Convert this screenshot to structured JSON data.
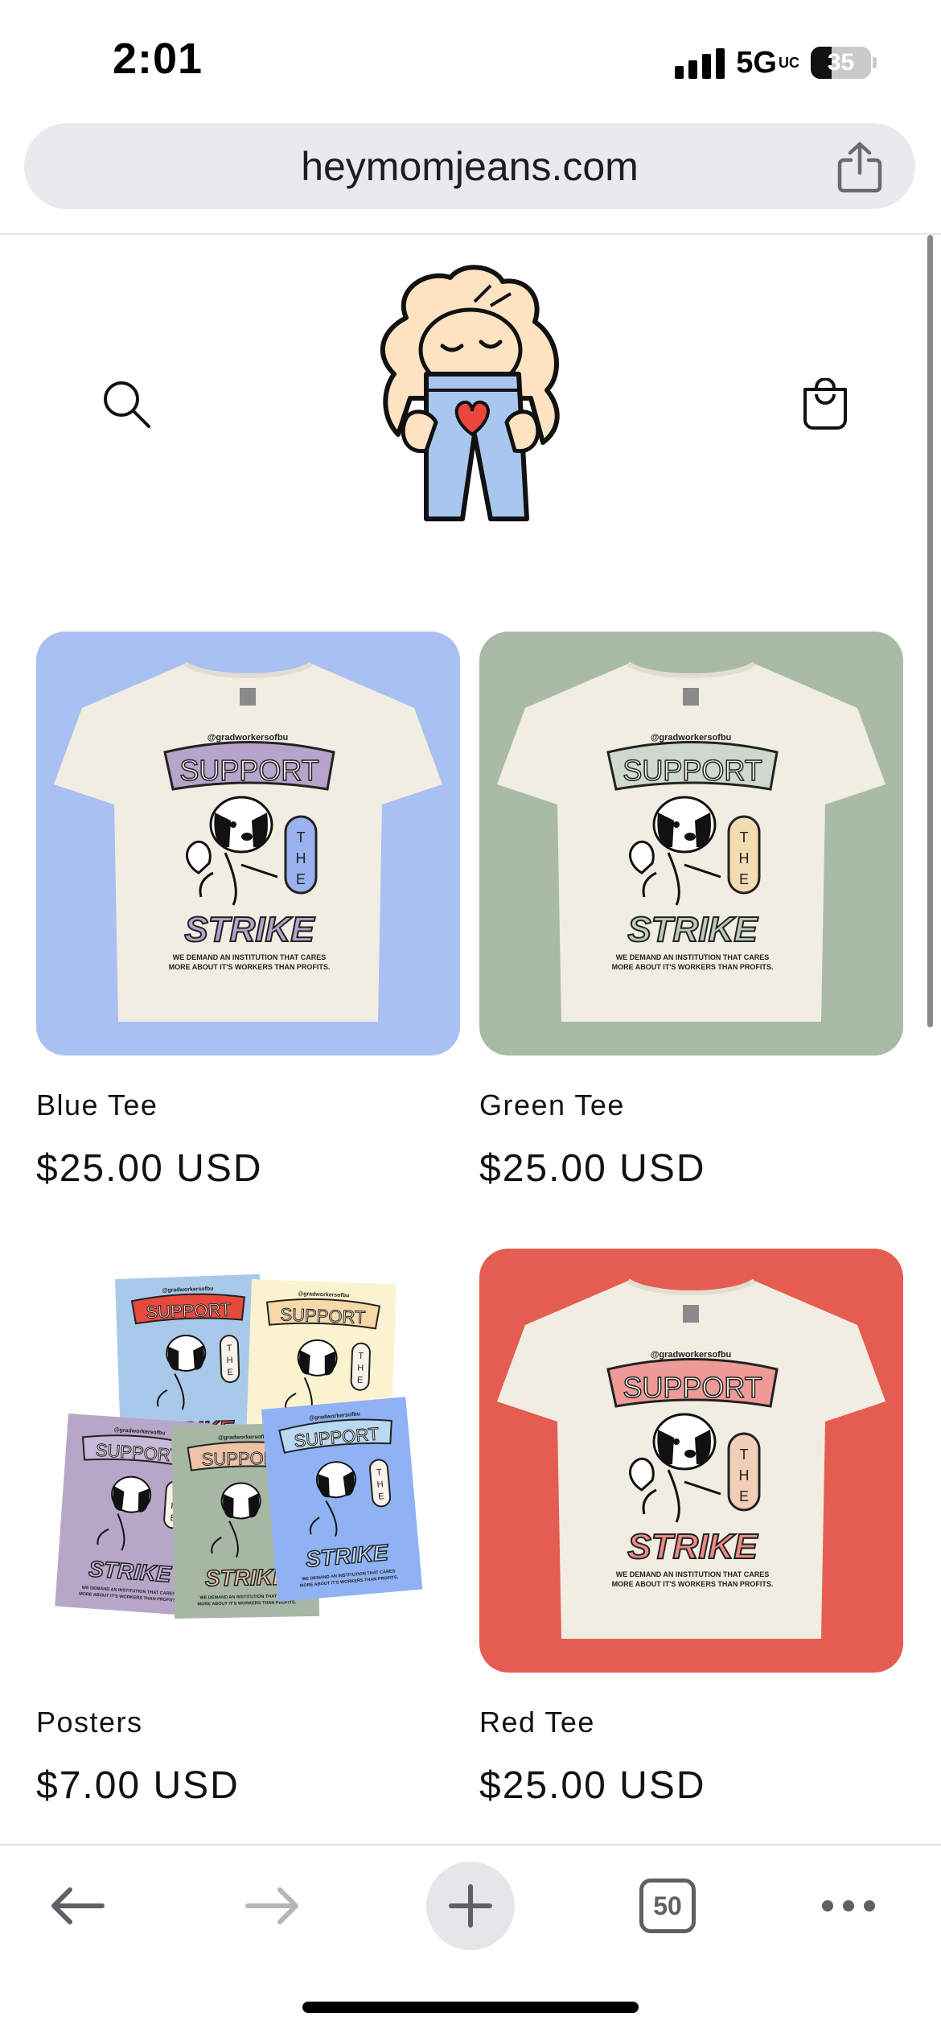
{
  "status_bar": {
    "time": "2:01",
    "network": "5G",
    "network_suffix": "UC",
    "battery_percent": "35",
    "battery_level": 0.35,
    "signal_bars": 4
  },
  "browser": {
    "url": "heymomjeans.com",
    "share_icon": "share-icon"
  },
  "header": {
    "search_icon": "search-icon",
    "cart_icon": "shopping-bag-icon"
  },
  "products": [
    {
      "title": "Blue Tee",
      "price": "$25.00 USD",
      "bg": "#a9c0f2",
      "accent": "#b6a4cc",
      "accent2": "#9ab2ef",
      "word_fill": "#b6a4cc"
    },
    {
      "title": "Green Tee",
      "price": "$25.00 USD",
      "bg": "#a8bba5",
      "accent": "#cdd9cd",
      "accent2": "#f1dcb3",
      "word_fill": "#bccbbb"
    },
    {
      "title": "Posters",
      "price": "$7.00 USD",
      "bg": "#ffffff"
    },
    {
      "title": "Red Tee",
      "price": "$25.00 USD",
      "bg": "#e45d50",
      "accent": "#ee9a97",
      "accent2": "#f2cdb8",
      "word_fill": "#ef8a84"
    }
  ],
  "shirt_text": {
    "handle": "@gradworkersofbu",
    "support": "SUPPORT",
    "the": "THE",
    "strike": "STRIKE",
    "tagline1": "WE DEMAND AN INSTITUTION THAT CARES",
    "tagline2": "MORE ABOUT IT'S WORKERS THAN PROFITS."
  },
  "toolbar": {
    "tab_count": "50"
  },
  "colors": {
    "url_bar_bg": "#e9eaec",
    "toolbar_icon": "#5f6066",
    "disabled_icon": "#b5b6ba"
  }
}
